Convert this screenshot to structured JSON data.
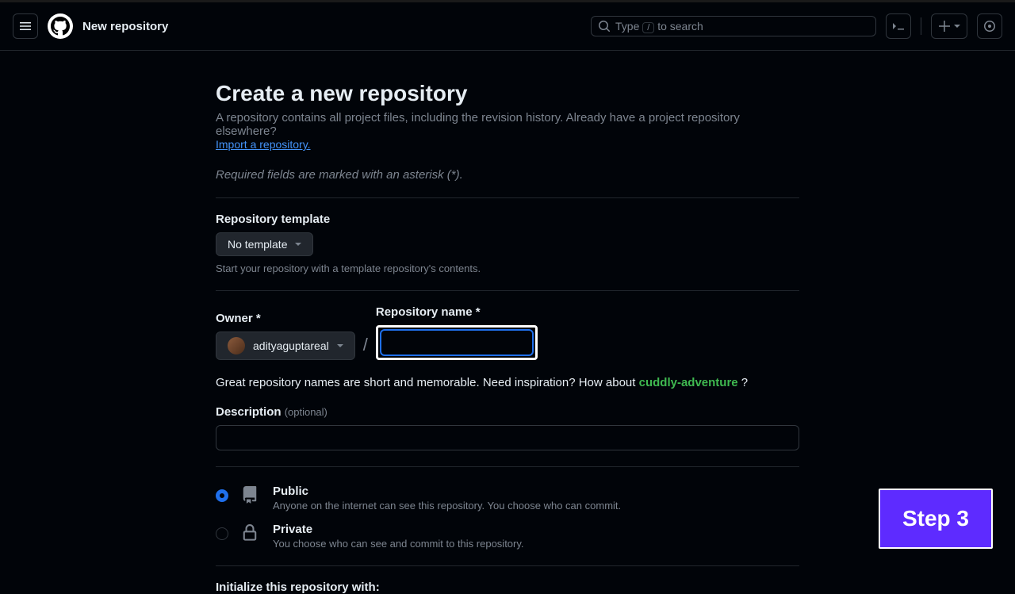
{
  "header": {
    "page_name": "New repository",
    "search_prefix": "Type ",
    "search_key": "/",
    "search_suffix": " to search"
  },
  "main": {
    "title": "Create a new repository",
    "subtitle_a": "A repository contains all project files, including the revision history. Already have a project repository elsewhere? ",
    "import_link": "Import a repository.",
    "required_note": "Required fields are marked with an asterisk (*).",
    "template_label": "Repository template",
    "template_value": "No template",
    "template_hint": "Start your repository with a template repository's contents.",
    "owner_label": "Owner *",
    "owner_value": "adityaguptareal",
    "reponame_label": "Repository name *",
    "name_hint_pre": "Great repository names are short and memorable. Need inspiration? How about ",
    "name_suggestion": "cuddly-adventure",
    "name_hint_post": " ?",
    "desc_label": "Description ",
    "desc_optional": "(optional)",
    "public_title": "Public",
    "public_desc": "Anyone on the internet can see this repository. You choose who can commit.",
    "private_title": "Private",
    "private_desc": "You choose who can see and commit to this repository.",
    "init_label": "Initialize this repository with:"
  },
  "overlay": {
    "step_label": "Step 3"
  }
}
